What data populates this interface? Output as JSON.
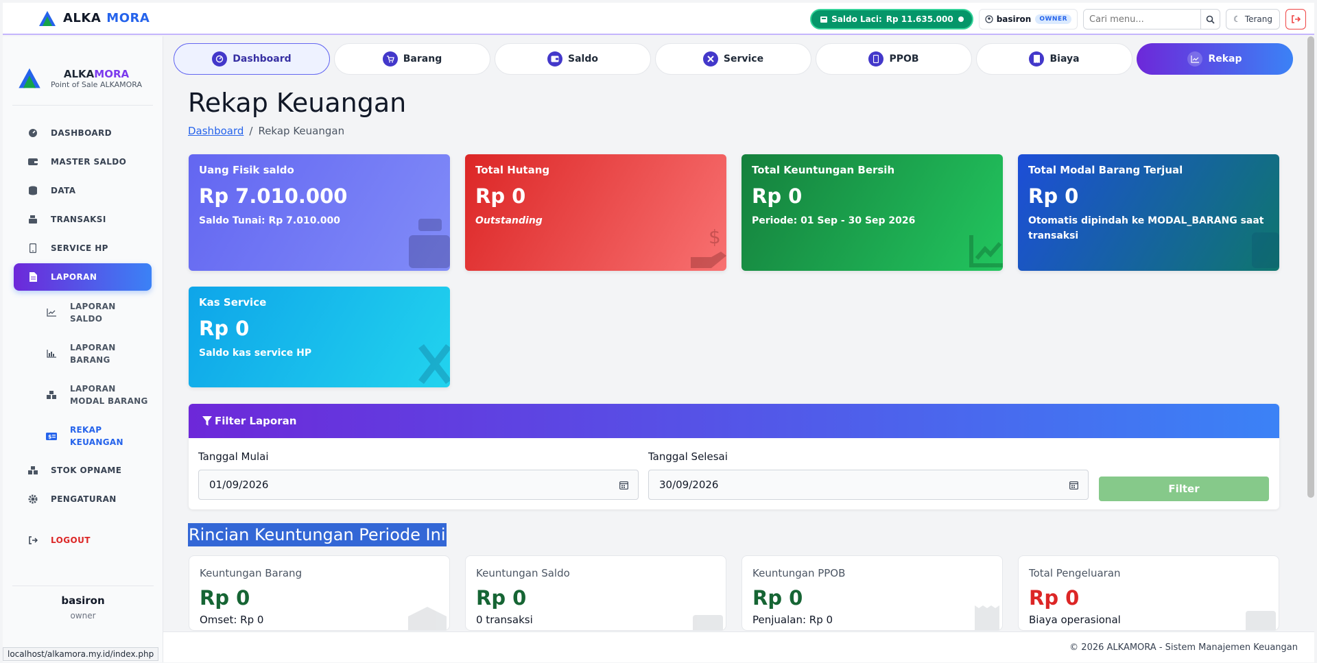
{
  "app": {
    "brand_a": "ALKA",
    "brand_b": "MORA"
  },
  "topbar": {
    "saldo_label": "Saldo Laci:",
    "saldo_value": "Rp 11.635.000",
    "user": "basiron",
    "role": "OWNER",
    "search_placeholder": "Cari menu...",
    "theme_label": "Terang"
  },
  "sidebar": {
    "brand_a": "ALKA",
    "brand_b": "MORA",
    "subtitle": "Point of Sale ALKAMORA",
    "items": [
      {
        "label": "DASHBOARD",
        "icon": "gauge-icon"
      },
      {
        "label": "MASTER SALDO",
        "icon": "wallet-icon"
      },
      {
        "label": "DATA",
        "icon": "database-icon"
      },
      {
        "label": "TRANSAKSI",
        "icon": "cash-register-icon"
      },
      {
        "label": "SERVICE HP",
        "icon": "mobile-icon"
      },
      {
        "label": "LAPORAN",
        "icon": "file-icon"
      }
    ],
    "subitems": [
      {
        "l1": "LAPORAN",
        "l2": "SALDO",
        "icon": "line-chart-icon"
      },
      {
        "l1": "LAPORAN",
        "l2": "BARANG",
        "icon": "bar-chart-icon"
      },
      {
        "l1": "LAPORAN",
        "l2": "MODAL BARANG",
        "icon": "boxes-icon"
      },
      {
        "l1": "REKAP",
        "l2": "KEUANGAN",
        "icon": "money-bill-icon"
      }
    ],
    "items2": [
      {
        "label": "STOK OPNAME",
        "icon": "boxes-icon"
      },
      {
        "label": "PENGATURAN",
        "icon": "gear-icon"
      }
    ],
    "logout": "LOGOUT",
    "user_name": "basiron",
    "user_role": "owner"
  },
  "tabs": [
    "Dashboard",
    "Barang",
    "Saldo",
    "Service",
    "PPOB",
    "Biaya",
    "Rekap"
  ],
  "page": {
    "title": "Rekap Keuangan",
    "breadcrumb_link": "Dashboard",
    "breadcrumb_current": "Rekap Keuangan"
  },
  "cards": [
    {
      "label": "Uang Fisik saldo",
      "amount": "Rp 7.010.000",
      "sub": "Saldo Tunai: Rp 7.010.000"
    },
    {
      "label": "Total Hutang",
      "amount": "Rp 0",
      "sub": "Outstanding"
    },
    {
      "label": "Total Keuntungan Bersih",
      "amount": "Rp 0",
      "sub": "Periode: 01 Sep - 30 Sep 2026"
    },
    {
      "label": "Total Modal Barang Terjual",
      "amount": "Rp 0",
      "sub": "Otomatis dipindah ke MODAL_BARANG saat transaksi"
    },
    {
      "label": "Kas Service",
      "amount": "Rp 0",
      "sub": "Saldo kas service HP"
    }
  ],
  "filter": {
    "title": "Filter Laporan",
    "start_label": "Tanggal Mulai",
    "start_value": "01/09/2026",
    "end_label": "Tanggal Selesai",
    "end_value": "30/09/2026",
    "button": "Filter"
  },
  "section_title": "Rincian Keuntungan Periode Ini",
  "profit_cards": [
    {
      "label": "Keuntungan Barang",
      "amount": "Rp 0",
      "sub": "Omset: Rp 0"
    },
    {
      "label": "Keuntungan Saldo",
      "amount": "Rp 0",
      "sub": "0 transaksi"
    },
    {
      "label": "Keuntungan PPOB",
      "amount": "Rp 0",
      "sub": "Penjualan: Rp 0"
    },
    {
      "label": "Total Pengeluaran",
      "amount": "Rp 0",
      "sub": "Biaya operasional"
    }
  ],
  "footer": "© 2026 ALKAMORA - Sistem Manajemen Keuangan",
  "status_url": "localhost/alkamora.my.id/index.php",
  "colors": {
    "accent_start": "#6d28d9",
    "accent_end": "#3b82f6",
    "profit": "#166534",
    "expense": "#dc2626"
  }
}
